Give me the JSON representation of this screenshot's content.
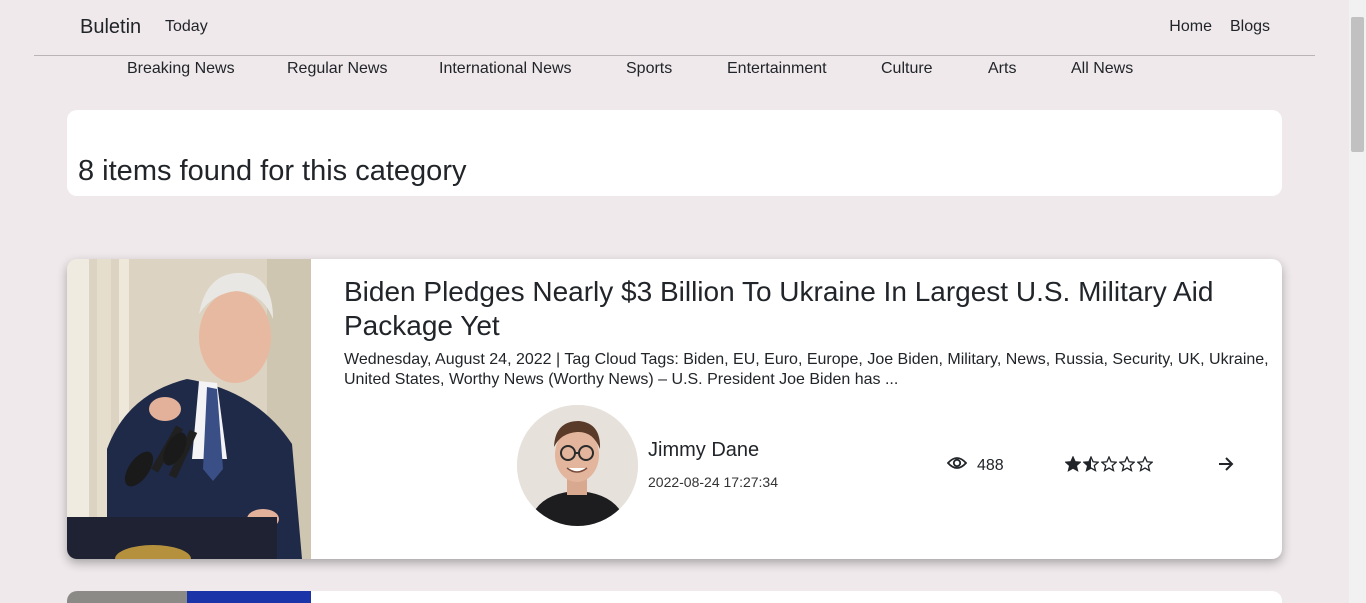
{
  "header": {
    "brand": "Buletin",
    "today": "Today",
    "nav": [
      "Home",
      "Blogs"
    ]
  },
  "categories": [
    "Breaking News",
    "Regular News",
    "International News",
    "Sports",
    "Entertainment",
    "Culture",
    "Arts",
    "All News"
  ],
  "results": {
    "title": "8 items found for this category"
  },
  "article": {
    "title": "Biden Pledges Nearly $3 Billion To Ukraine In Largest U.S. Military Aid Package Yet",
    "excerpt": "Wednesday, August 24, 2022 | Tag Cloud Tags: Biden, EU, Euro, Europe, Joe Biden, Military, News, Russia, Security, UK, Ukraine, United States, Worthy News (Worthy News) – U.S. President Joe Biden has ...",
    "author": "Jimmy Dane",
    "date": "2022-08-24 17:27:34",
    "views": "488",
    "rating": 1.5,
    "rating_max": 5,
    "icons": {
      "views": "eye-icon",
      "open": "arrow-right-icon",
      "rating": "star-icon"
    }
  },
  "colors": {
    "background": "#efe9eb",
    "card": "#ffffff",
    "text": "#212529"
  }
}
